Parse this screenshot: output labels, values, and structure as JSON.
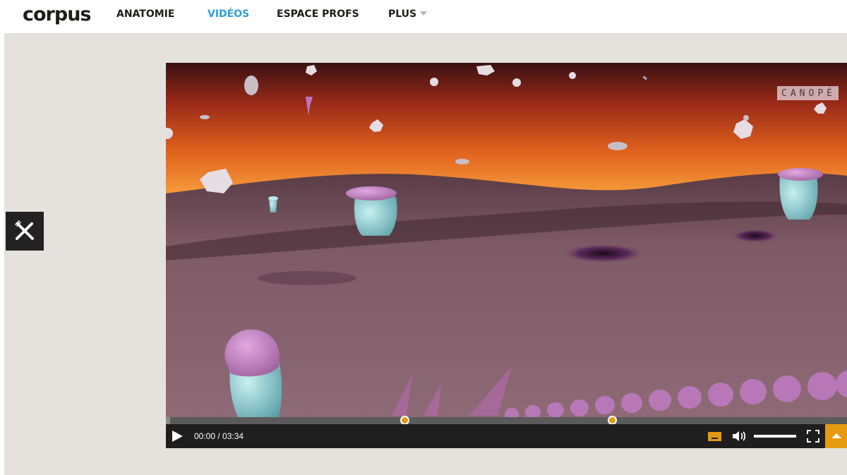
{
  "header": {
    "logo": "corpus",
    "nav": [
      {
        "label": "ANATOMIE",
        "active": false
      },
      {
        "label": "VIDÉOS",
        "active": true
      },
      {
        "label": "ESPACE PROFS",
        "active": false
      },
      {
        "label": "PLUS",
        "active": false,
        "dropdown": true
      }
    ]
  },
  "sidebar": {
    "tool_icon": "knife-fork-icon"
  },
  "video": {
    "watermark": "CANOPÉ",
    "current_time": "00:00",
    "duration": "/ 03:34",
    "progress_fraction": 0.0,
    "chapter_markers_fraction": [
      0.35,
      0.655
    ],
    "volume_fraction": 1.0,
    "accent_color": "#e69a12",
    "icons": {
      "play": "play-icon",
      "captions": "captions-icon",
      "volume": "volume-icon",
      "fullscreen": "fullscreen-icon",
      "toggle": "chevron-up-icon"
    }
  }
}
